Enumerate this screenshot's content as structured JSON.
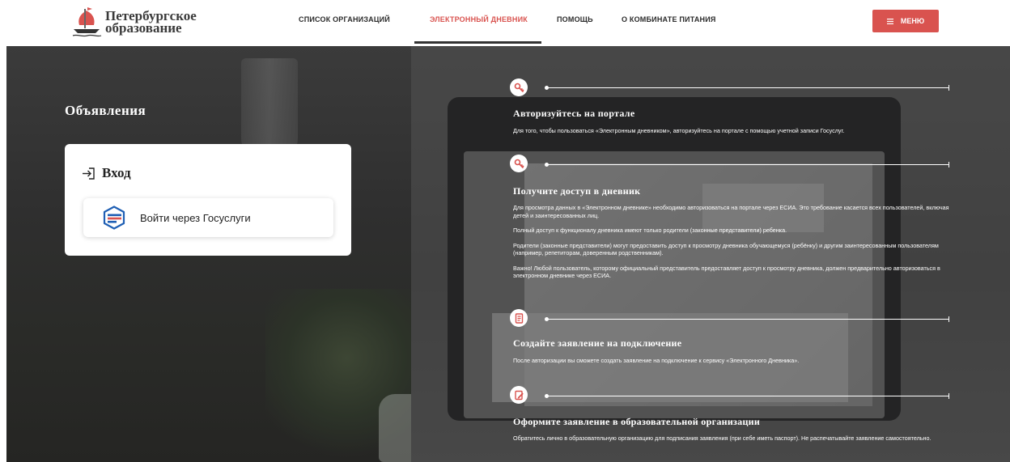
{
  "header": {
    "logo_line1": "Петербургское",
    "logo_line2": "образование",
    "nav": [
      {
        "label": "Список организаций",
        "active": false
      },
      {
        "label": "Электронный дневник",
        "active": true
      },
      {
        "label": "Помощь",
        "active": false
      },
      {
        "label": "О комбинате питания",
        "active": false
      }
    ],
    "menu_label": "МЕНЮ",
    "menu_icon": "hamburger-icon"
  },
  "announcements": {
    "title": "Объявления"
  },
  "login": {
    "title": "Вход",
    "icon": "login-arrow-icon",
    "gosuslugi_label": "Войти через Госуслуги",
    "gosuslugi_icon": "gosuslugi-logo-icon"
  },
  "steps": [
    {
      "icon": "key-icon",
      "title": "Авторизуйтесь на портале",
      "paragraphs": [
        "Для того, чтобы пользоваться «Электронным дневником», авторизуйтесь на портале с помощью учетной записи Госуслуг."
      ]
    },
    {
      "icon": "key-icon",
      "title": "Получите доступ в дневник",
      "paragraphs": [
        "Для просмотра данных в «Электронном дневнике» необходимо авторизоваться на портале через ЕСИА. Это требование касается всех пользователей, включая детей и заинтересованных лиц.",
        "Полный доступ к функционалу дневника имеют только родители (законные представители) ребенка.",
        "Родители (законные представители) могут предоставить доступ к просмотру дневника обучающемуся (ребёнку) и другим заинтересованным пользователям (например, репетиторам, доверенным родственникам).",
        "Важно! Любой пользователь, которому официальный представитель предоставляет доступ к просмотру дневника, должен предварительно авторизоваться в электронном дневнике через ЕСИА."
      ]
    },
    {
      "icon": "document-icon",
      "title": "Создайте заявление на подключение",
      "paragraphs": [
        "После авторизации вы сможете создать заявление на подключение к сервису «Электронного Дневника»."
      ]
    },
    {
      "icon": "edit-document-icon",
      "title": "Оформите заявление в образовательной организации",
      "paragraphs": [
        "Обратитесь лично в образовательную организацию для подписания заявления (при себе иметь паспорт). Не распечатывайте заявление самостоятельно."
      ]
    }
  ],
  "colors": {
    "accent": "#d9534f",
    "text_dark": "#2b2b2b",
    "white": "#ffffff"
  }
}
